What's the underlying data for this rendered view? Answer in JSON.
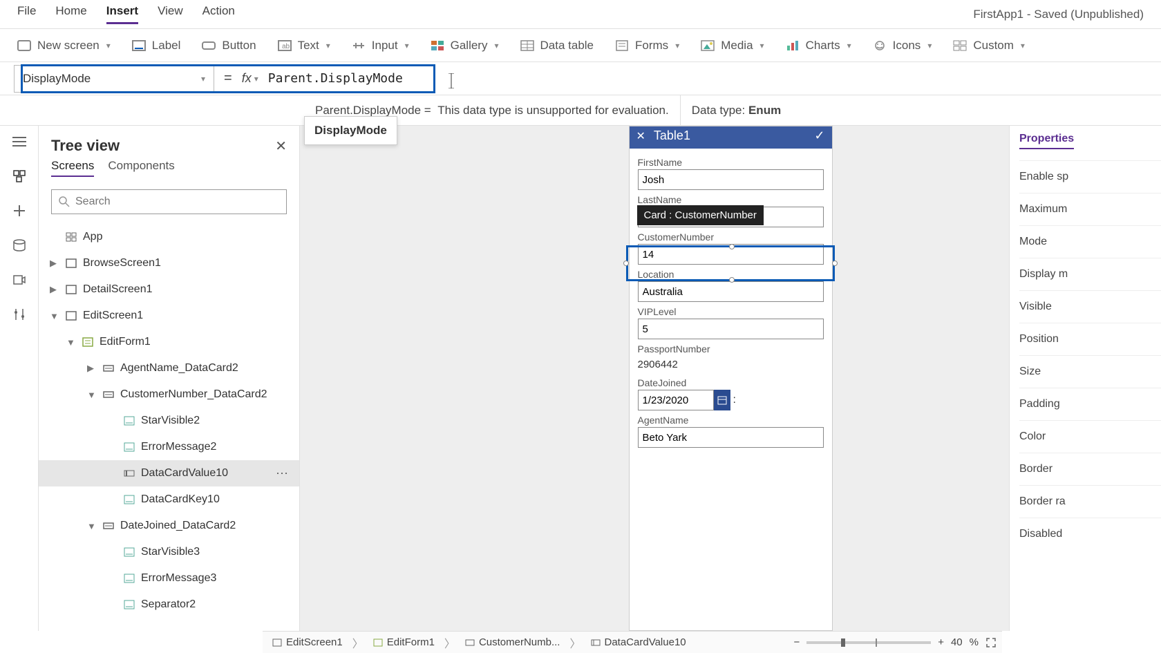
{
  "menu": {
    "items": [
      "File",
      "Home",
      "Insert",
      "View",
      "Action"
    ],
    "active": "Insert",
    "app_title": "FirstApp1 - Saved (Unpublished)"
  },
  "ribbon": {
    "new_screen": "New screen",
    "label": "Label",
    "button": "Button",
    "text": "Text",
    "input": "Input",
    "gallery": "Gallery",
    "data_table": "Data table",
    "forms": "Forms",
    "media": "Media",
    "charts": "Charts",
    "icons": "Icons",
    "custom": "Custom"
  },
  "formula": {
    "property": "DisplayMode",
    "expression": "Parent.DisplayMode",
    "result_lhs": "Parent.DisplayMode  =",
    "result_rhs": "This data type is unsupported for evaluation.",
    "datatype_label": "Data type:",
    "datatype_value": "Enum",
    "tooltip": "DisplayMode"
  },
  "tree": {
    "title": "Tree view",
    "tabs": [
      "Screens",
      "Components"
    ],
    "search_placeholder": "Search",
    "items": [
      {
        "label": "App",
        "depth": 1,
        "icon": "app"
      },
      {
        "label": "BrowseScreen1",
        "depth": 1,
        "icon": "screen",
        "toggle": "▶"
      },
      {
        "label": "DetailScreen1",
        "depth": 1,
        "icon": "screen",
        "toggle": "▶"
      },
      {
        "label": "EditScreen1",
        "depth": 1,
        "icon": "screen",
        "toggle": "▼"
      },
      {
        "label": "EditForm1",
        "depth": 2,
        "icon": "form",
        "toggle": "▼"
      },
      {
        "label": "AgentName_DataCard2",
        "depth": 3,
        "icon": "card",
        "toggle": "▶"
      },
      {
        "label": "CustomerNumber_DataCard2",
        "depth": 3,
        "icon": "card",
        "toggle": "▼"
      },
      {
        "label": "StarVisible2",
        "depth": 4,
        "icon": "label"
      },
      {
        "label": "ErrorMessage2",
        "depth": 4,
        "icon": "label"
      },
      {
        "label": "DataCardValue10",
        "depth": 4,
        "icon": "textinput",
        "selected": true
      },
      {
        "label": "DataCardKey10",
        "depth": 4,
        "icon": "label"
      },
      {
        "label": "DateJoined_DataCard2",
        "depth": 3,
        "icon": "card",
        "toggle": "▼"
      },
      {
        "label": "StarVisible3",
        "depth": 4,
        "icon": "label"
      },
      {
        "label": "ErrorMessage3",
        "depth": 4,
        "icon": "label"
      },
      {
        "label": "Separator2",
        "depth": 4,
        "icon": "label"
      }
    ]
  },
  "canvas": {
    "screen_title": "Table1",
    "tooltip": "Card : CustomerNumber",
    "fields": [
      {
        "label": "FirstName",
        "value": "Josh"
      },
      {
        "label": "LastName",
        "value": ""
      },
      {
        "label": "CustomerNumber",
        "value": "14",
        "selected": true
      },
      {
        "label": "Location",
        "value": "Australia"
      },
      {
        "label": "VIPLevel",
        "value": "5"
      },
      {
        "label": "PassportNumber",
        "value": "2906442",
        "static": true
      },
      {
        "label": "DateJoined",
        "value": "1/23/2020",
        "date": true
      },
      {
        "label": "AgentName",
        "value": "Beto Yark"
      }
    ]
  },
  "properties": {
    "tab": "Properties",
    "rows": [
      "Enable sp",
      "Maximum",
      "Mode",
      "Display m",
      "Visible",
      "Position",
      "Size",
      "Padding",
      "Color",
      "Border",
      "Border ra",
      "Disabled"
    ]
  },
  "breadcrumb": {
    "items": [
      "EditScreen1",
      "EditForm1",
      "CustomerNumb...",
      "DataCardValue10"
    ],
    "zoom_pct": "40",
    "zoom_unit": "%"
  }
}
